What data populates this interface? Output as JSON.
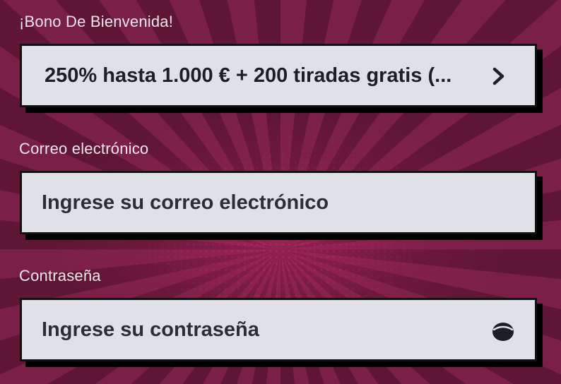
{
  "bonus": {
    "label": "¡Bono De Bienvenida!",
    "selected": "250% hasta 1.000 € + 200 tiradas gratis (...",
    "icon": "chevron-right-icon"
  },
  "email": {
    "label": "Correo electrónico",
    "placeholder": "Ingrese su correo electrónico"
  },
  "password": {
    "label": "Contraseña",
    "placeholder": "Ingrese su contraseña",
    "icon": "eye-icon"
  },
  "colors": {
    "background": "#6e1b3e",
    "field": "#dfe1e6",
    "field_border": "#111111",
    "label_text": "#f3e7ec",
    "field_text": "#1c1f26"
  }
}
